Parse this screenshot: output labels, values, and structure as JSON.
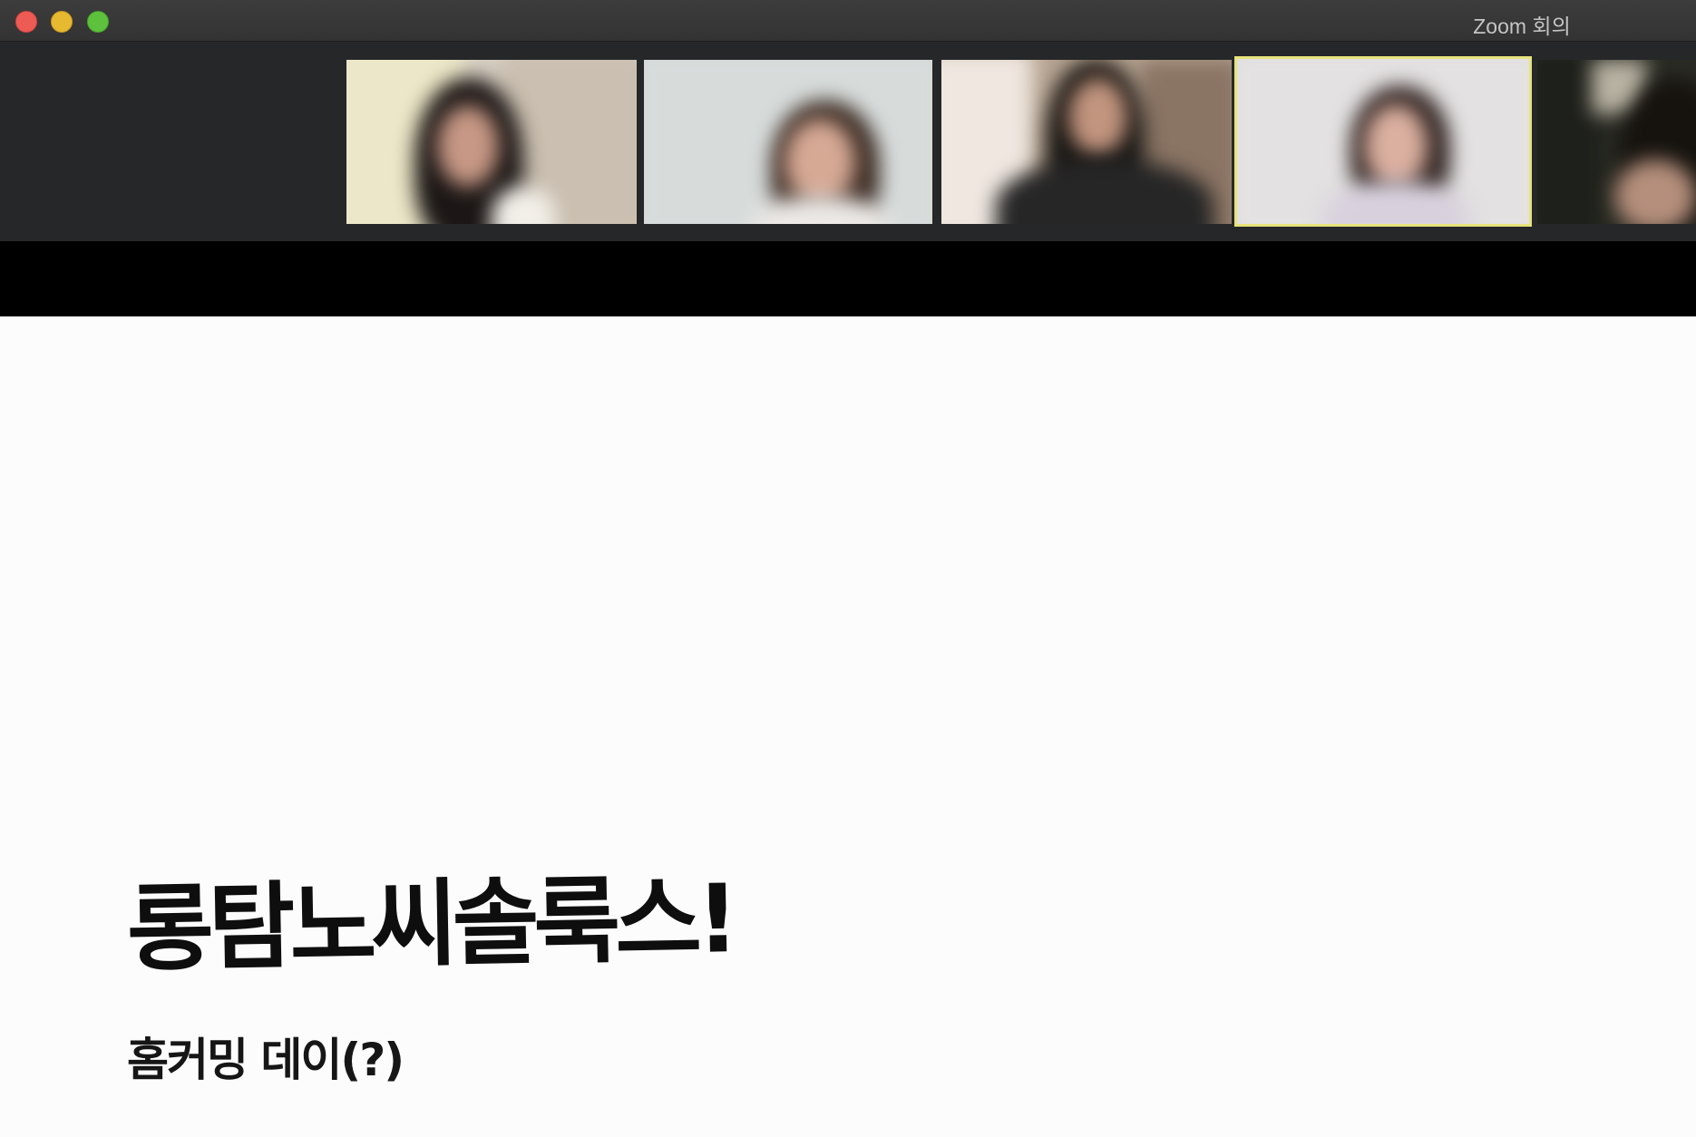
{
  "window": {
    "title": "Zoom 회의"
  },
  "gallery": {
    "participants": [
      {
        "id": "p1",
        "active": false
      },
      {
        "id": "p2",
        "active": false
      },
      {
        "id": "p3",
        "active": false
      },
      {
        "id": "p4",
        "active": true
      },
      {
        "id": "p5",
        "active": false
      }
    ],
    "active_speaker_color": "#e6e37a"
  },
  "slide": {
    "title": "롱탐노씨솔룩스!",
    "subtitle": "홈커밍 데이(?)"
  },
  "colors": {
    "titlebar": "#3a3939",
    "gallery_background": "#262728",
    "slide_background": "#fdfcfc",
    "close": "#ee5b55",
    "minimize": "#e6b930",
    "maximize": "#5ec13d"
  }
}
